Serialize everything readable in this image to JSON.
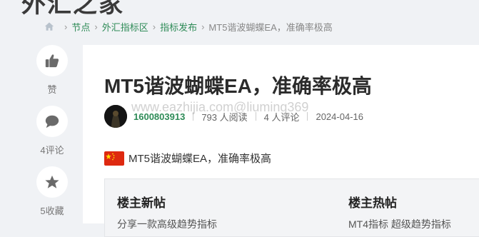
{
  "site": {
    "logo_text": "外汇之家"
  },
  "breadcrumb": {
    "items": [
      "节点",
      "外汇指标区",
      "指标发布"
    ],
    "current": "MT5谐波蝴蝶EA，准确率极高"
  },
  "sidebar": {
    "like_label": "赞",
    "comment_label": "4评论",
    "favorite_label": "5收藏"
  },
  "post": {
    "title": "MT5谐波蝴蝶EA，准确率极高",
    "author": "1600803913",
    "views": "793 人阅读",
    "comments": "4 人评论",
    "date": "2024-04-16",
    "watermark": "www.eazhijia.com@liuming369",
    "flag_icon": "china-flag-icon",
    "subtitle": "MT5谐波蝴蝶EA，准确率极高"
  },
  "related": {
    "new_title": "楼主新帖",
    "new_item": "分享一款高级趋势指标",
    "hot_title": "楼主热帖",
    "hot_item": "MT4指标 超级趋势指标"
  },
  "colors": {
    "accent": "#2e8b57",
    "background": "#f0f2f5"
  }
}
